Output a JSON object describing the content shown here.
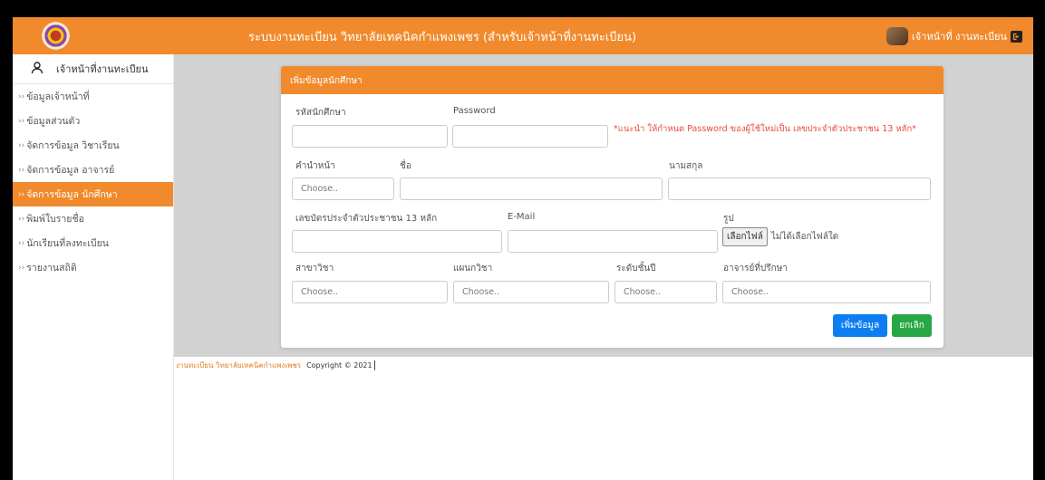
{
  "header": {
    "title": "ระบบงานทะเบียน วิทยาลัยเทคนิคกำแพงเพชร (สำหรับเจ้าหน้าที่งานทะเบียน)",
    "user_label": "เจ้าหน้าที่ งานทะเบียน",
    "logo_icon": "college-seal-icon",
    "logout_icon": "logout-icon",
    "brand_color": "#f08a2c"
  },
  "sidebar": {
    "user_label": "เจ้าหน้าที่งานทะเบียน",
    "items": [
      {
        "label": "ข้อมูลเจ้าหน้าที่",
        "active": false
      },
      {
        "label": "ข้อมูลส่วนตัว",
        "active": false
      },
      {
        "label": "จัดการข้อมูล วิชาเรียน",
        "active": false
      },
      {
        "label": "จัดการข้อมูล อาจารย์",
        "active": false
      },
      {
        "label": "จัดการข้อมูล นักศึกษา",
        "active": true
      },
      {
        "label": "พิมพ์ใบรายชื่อ",
        "active": false
      },
      {
        "label": "นักเรียนที่ลงทะเบียน",
        "active": false
      },
      {
        "label": "รายงานสถิติ",
        "active": false
      }
    ]
  },
  "form": {
    "title": "เพิ่มข้อมูลนักศึกษา",
    "student_id_label": "รหัสนักศึกษา",
    "password_label": "Password",
    "password_note": "*แนะนำ ให้กำหนด Password ของผู้ใช้ใหม่เป็น เลขประจำตัวประชาชน 13 หลัก*",
    "prefix_label": "คำนำหน้า",
    "prefix_placeholder": "Choose..",
    "firstname_label": "ชื่อ",
    "lastname_label": "นามสกุล",
    "citizen_id_label": "เลขบัตรประจำตัวประชาชน 13 หลัก",
    "email_label": "E-Mail",
    "photo_label": "รูป",
    "file_button": "เลือกไฟล์",
    "file_status": "ไม่ได้เลือกไฟล์ใด",
    "major_label": "สาขาวิชา",
    "major_placeholder": "Choose..",
    "department_label": "แผนกวิชา",
    "department_placeholder": "Choose..",
    "level_label": "ระดับชั้นปี",
    "level_placeholder": "Choose..",
    "advisor_label": "อาจารย์ที่ปรึกษา",
    "advisor_placeholder": "Choose..",
    "submit_label": "เพิ่มข้อมูล",
    "cancel_label": "ยกเลิก"
  },
  "footer": {
    "school": "งานทะเบียน วิทยาลัยเทคนิคกำแพงเพชร",
    "copyright": "Copyright © 2021"
  }
}
